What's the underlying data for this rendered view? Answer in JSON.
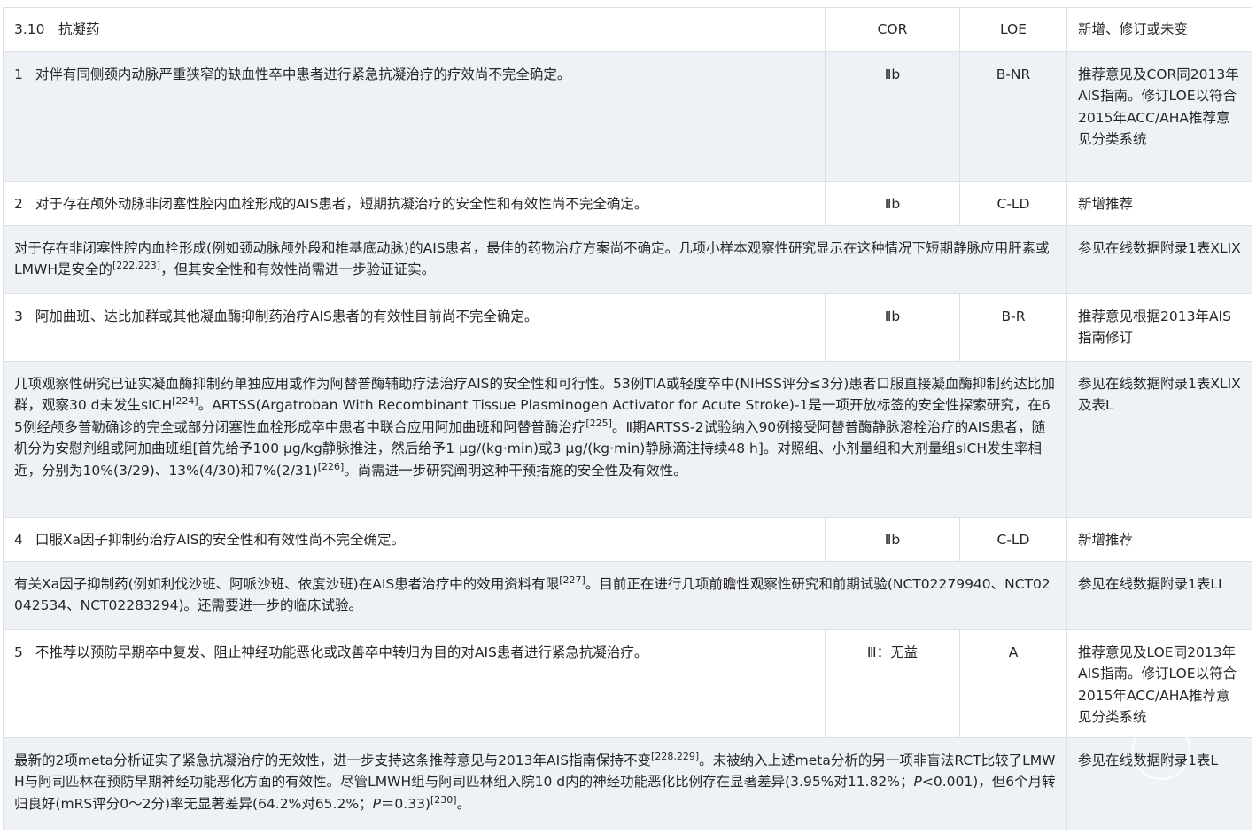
{
  "header": {
    "section": "3.10　抗凝药",
    "cor": "COR",
    "loe": "LOE",
    "status": "新增、修订或未变"
  },
  "recommendations": [
    {
      "num": "1",
      "text": "对伴有同侧颈内动脉严重狭窄的缺血性卒中患者进行紧急抗凝治疗的疗效尚不完全确定。",
      "cor": "Ⅱb",
      "loe": "B-NR",
      "status": "推荐意见及COR同2013年AIS指南。修订LOE以符合2015年ACC/AHA推荐意见分类系统"
    },
    {
      "num": "2",
      "text": "对于存在颅外动脉非闭塞性腔内血栓形成的AIS患者，短期抗凝治疗的安全性和有效性尚不完全确定。",
      "cor": "Ⅱb",
      "loe": "C-LD",
      "status": "新增推荐"
    },
    {
      "num": "3",
      "text": "阿加曲班、达比加群或其他凝血酶抑制药治疗AIS患者的有效性目前尚不完全确定。",
      "cor": "Ⅱb",
      "loe": "B-R",
      "status": "推荐意见根据2013年AIS指南修订"
    },
    {
      "num": "4",
      "text": "口服Ⅹa因子抑制药治疗AIS的安全性和有效性尚不完全确定。",
      "cor": "Ⅱb",
      "loe": "C-LD",
      "status": "新增推荐"
    },
    {
      "num": "5",
      "text": "不推荐以预防早期卒中复发、阻止神经功能恶化或改善卒中转归为目的对AIS患者进行紧急抗凝治疗。",
      "cor": "Ⅲ：无益",
      "loe": "A",
      "status": "推荐意见及LOE同2013年AIS指南。修订LOE以符合2015年ACC/AHA推荐意见分类系统"
    }
  ],
  "evidence": [
    {
      "parts": [
        "对于存在非闭塞性腔内血栓形成(例如颈动脉颅外段和椎基底动脉)的AIS患者，最佳的药物治疗方案尚不确定。几项小样本观察性研究显示在这种情况下短期静脉应用肝素或LMWH是安全的",
        "[222,223]",
        "，但其安全性和有效性尚需进一步验证证实。"
      ],
      "ref": "参见在线数据附录1表ⅩLIX"
    },
    {
      "parts": [
        "几项观察性研究已证实凝血酶抑制药单独应用或作为阿替普酶辅助疗法治疗AIS的安全性和可行性。53例TIA或轻度卒中(NIHSS评分≤3分)患者口服直接凝血酶抑制药达比加群，观察30 d未发生sICH",
        "[224]",
        "。ARTSS(Argatroban With Recombinant Tissue Plasminogen Activator for Acute Stroke)-1是一项开放标签的安全性探索研究，在65例经颅多普勒确诊的完全或部分闭塞性血栓形成卒中患者中联合应用阿加曲班和阿替普酶治疗",
        "[225]",
        "。Ⅱ期ARTSS-2试验纳入90例接受阿替普酶静脉溶栓治疗的AIS患者，随机分为安慰剂组或阿加曲班组[首先给予100 μg/kg静脉推注，然后给予1 μg/(kg·min)或3 μg/(kg·min)静脉滴注持续48 h]。对照组、小剂量组和大剂量组sICH发生率相近，分别为10%(3/29)、13%(4/30)和7%(2/31)",
        "[226]",
        "。尚需进一步研究阐明这种干预措施的安全性及有效性。"
      ],
      "ref": "参见在线数据附录1表ⅩLIX及表L"
    },
    {
      "parts": [
        "有关Ⅹa因子抑制药(例如利伐沙班、阿哌沙班、依度沙班)在AIS患者治疗中的效用资料有限",
        "[227]",
        "。目前正在进行几项前瞻性观察性研究和前期试验(NCT02279940、NCT02042534、NCT02283294)。还需要进一步的临床试验。"
      ],
      "ref": "参见在线数据附录1表LⅠ"
    },
    {
      "parts": [
        "最新的2项meta分析证实了紧急抗凝治疗的无效性，进一步支持这条推荐意见与2013年AIS指南保持不变",
        "[228,229]",
        "。未被纳入上述meta分析的另一项非盲法RCT比较了LMWH与阿司匹林在预防早期神经功能恶化方面的有效性。尽管LMWH组与阿司匹林组入院10 d内的神经功能恶化比例存在显著差异(3.95%对11.82%；",
        "P",
        "<0.001)，但6个月转归良好(mRS评分0～2分)率无显著差异(64.2%对65.2%；",
        "P",
        "＝0.33)",
        "[230]",
        "。"
      ],
      "ref": "参见在线数据附录1表L"
    }
  ]
}
